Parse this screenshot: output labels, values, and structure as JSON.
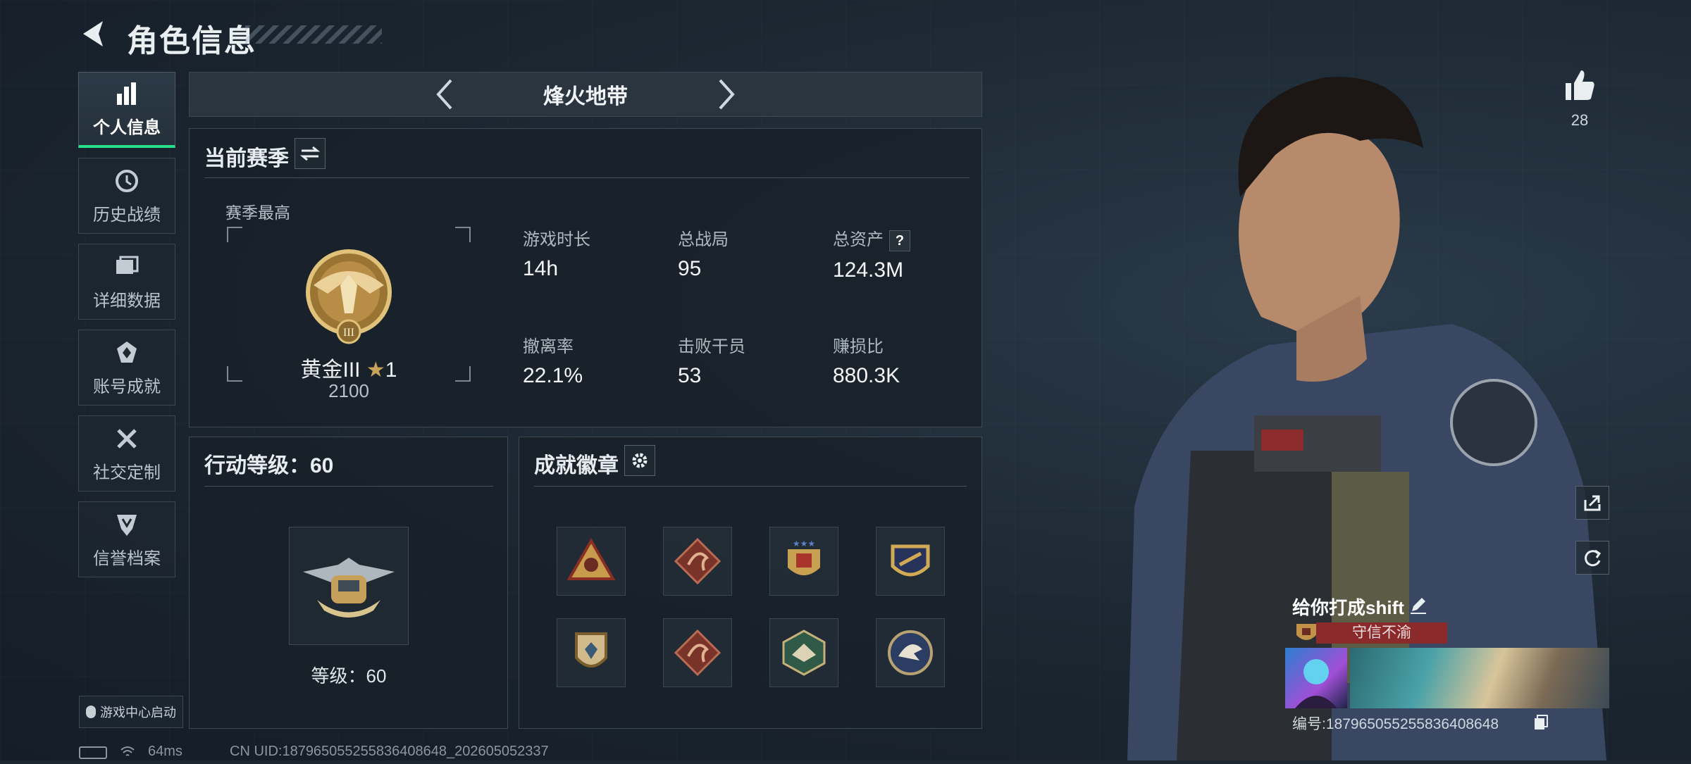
{
  "header": {
    "title": "角色信息"
  },
  "sidebar": {
    "items": [
      {
        "label": "个人信息",
        "icon": "bar-chart-icon",
        "active": true
      },
      {
        "label": "历史战绩",
        "icon": "history-icon"
      },
      {
        "label": "详细数据",
        "icon": "folder-icon"
      },
      {
        "label": "账号成就",
        "icon": "achievement-icon"
      },
      {
        "label": "社交定制",
        "icon": "tools-icon"
      },
      {
        "label": "信誉档案",
        "icon": "shield-icon"
      }
    ],
    "launch_label": "游戏中心启动"
  },
  "mode": {
    "name": "烽火地带"
  },
  "season": {
    "title": "当前赛季",
    "best_label": "赛季最高",
    "rank_name": "黄金III",
    "rank_stars": "1",
    "rank_score": "2100",
    "stats": [
      {
        "label": "游戏时长",
        "value": "14h"
      },
      {
        "label": "总战局",
        "value": "95"
      },
      {
        "label": "总资产",
        "value": "124.3M",
        "help": "?"
      },
      {
        "label": "撤离率",
        "value": "22.1%"
      },
      {
        "label": "击败干员",
        "value": "53"
      },
      {
        "label": "赚损比",
        "value": "880.3K"
      }
    ]
  },
  "level": {
    "title": "行动等级：60",
    "label": "等级：60"
  },
  "badges": {
    "title": "成就徽章"
  },
  "profile": {
    "likes": "28",
    "name": "给你打成shift",
    "honor": "守信不渝",
    "id_text": "编号:1879650552558364086​48"
  },
  "status_bar": {
    "ping": "64ms",
    "uid": "CN UID:1879650552558364086​48_202605052337"
  },
  "colors": {
    "accent": "#27e08a",
    "gold": "#c9a35a"
  }
}
